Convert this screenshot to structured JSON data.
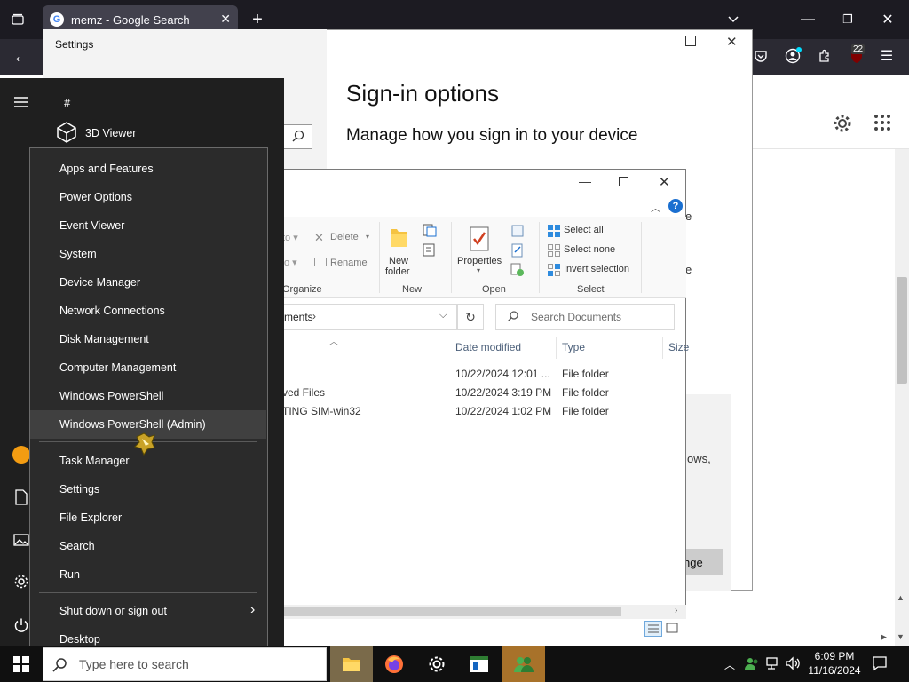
{
  "browser": {
    "tab_title": "memz - Google Search",
    "badge_count": "22"
  },
  "settings": {
    "window_title": "Settings",
    "heading": "Sign-in options",
    "subheading": "Manage how you sign in to your device",
    "partial_text_1": "ows,",
    "partial_button": "nge"
  },
  "explorer": {
    "ribbon": {
      "delete": "Delete",
      "rename": "Rename",
      "new_folder_1": "New",
      "new_folder_2": "folder",
      "properties": "Properties",
      "select_all": "Select all",
      "select_none": "Select none",
      "invert_selection": "Invert selection",
      "group_organize": "Organize",
      "group_new": "New",
      "group_open": "Open",
      "group_select": "Select"
    },
    "address": "ments",
    "search_placeholder": "Search Documents",
    "columns": {
      "date": "Date modified",
      "type": "Type",
      "size": "Size"
    },
    "rows": [
      {
        "name": "",
        "date": "10/22/2024 12:01 ...",
        "type": "File folder"
      },
      {
        "name": "ved Files",
        "date": "10/22/2024 3:19 PM",
        "type": "File folder"
      },
      {
        "name": "TING SIM-win32",
        "date": "10/22/2024 1:02 PM",
        "type": "File folder"
      }
    ]
  },
  "start": {
    "section_letter": "#",
    "app_3d_viewer": "3D Viewer"
  },
  "winx_menu": {
    "items": [
      "Apps and Features",
      "Power Options",
      "Event Viewer",
      "System",
      "Device Manager",
      "Network Connections",
      "Disk Management",
      "Computer Management",
      "Windows PowerShell",
      "Windows PowerShell (Admin)",
      "Task Manager",
      "Settings",
      "File Explorer",
      "Search",
      "Run",
      "Shut down or sign out",
      "Desktop"
    ]
  },
  "taskbar": {
    "search_placeholder": "Type here to search",
    "time": "6:09 PM",
    "date": "11/16/2024"
  }
}
